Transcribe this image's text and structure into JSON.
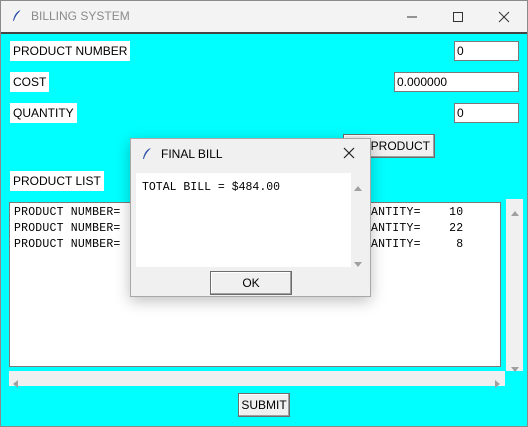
{
  "window": {
    "title": "BILLING SYSTEM",
    "controls": [
      "minimize",
      "maximize",
      "close"
    ]
  },
  "form": {
    "product_number_label": "PRODUCT NUMBER",
    "product_number_value": "0",
    "cost_label": "COST",
    "cost_value": "0.000000",
    "quantity_label": "QUANTITY",
    "quantity_value": "0",
    "add_product_button": "ADD PRODUCT",
    "add_product_visible": "D PRODUCT",
    "product_list_label": "PRODUCT LIST",
    "submit_button": "SUBMIT"
  },
  "product_list": {
    "lines": [
      {
        "left": "PRODUCT NUMBER=",
        "right": "ANTITY=    10"
      },
      {
        "left": "PRODUCT NUMBER=",
        "right": "ANTITY=    22"
      },
      {
        "left": "PRODUCT NUMBER=",
        "right": "ANTITY=     8"
      }
    ]
  },
  "dialog": {
    "title": "FINAL BILL",
    "message": "TOTAL BILL = $484.00",
    "ok_button": "OK"
  },
  "colors": {
    "background": "#00ffff",
    "titlebar": "#f3f3f3",
    "button_face": "#f0f0f0"
  },
  "icons": [
    "feather-icon",
    "minimize-icon",
    "maximize-icon",
    "close-icon",
    "chevron-up-icon",
    "chevron-down-icon",
    "chevron-left-icon",
    "chevron-right-icon"
  ]
}
